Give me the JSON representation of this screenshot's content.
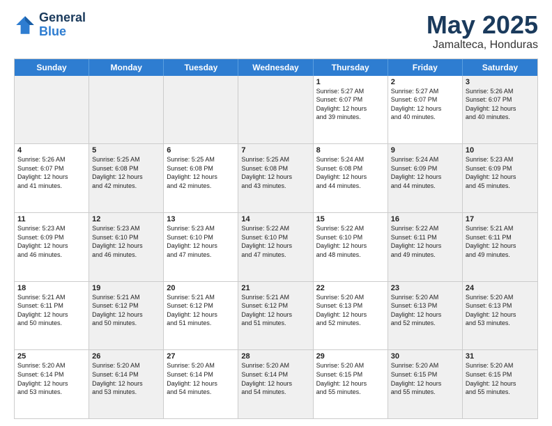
{
  "header": {
    "logo_line1": "General",
    "logo_line2": "Blue",
    "title": "May 2025",
    "subtitle": "Jamalteca, Honduras"
  },
  "weekdays": [
    "Sunday",
    "Monday",
    "Tuesday",
    "Wednesday",
    "Thursday",
    "Friday",
    "Saturday"
  ],
  "rows": [
    [
      {
        "day": "",
        "text": "",
        "shade": true
      },
      {
        "day": "",
        "text": "",
        "shade": true
      },
      {
        "day": "",
        "text": "",
        "shade": true
      },
      {
        "day": "",
        "text": "",
        "shade": true
      },
      {
        "day": "1",
        "text": "Sunrise: 5:27 AM\nSunset: 6:07 PM\nDaylight: 12 hours\nand 39 minutes."
      },
      {
        "day": "2",
        "text": "Sunrise: 5:27 AM\nSunset: 6:07 PM\nDaylight: 12 hours\nand 40 minutes."
      },
      {
        "day": "3",
        "text": "Sunrise: 5:26 AM\nSunset: 6:07 PM\nDaylight: 12 hours\nand 40 minutes.",
        "shade": true
      }
    ],
    [
      {
        "day": "4",
        "text": "Sunrise: 5:26 AM\nSunset: 6:07 PM\nDaylight: 12 hours\nand 41 minutes."
      },
      {
        "day": "5",
        "text": "Sunrise: 5:25 AM\nSunset: 6:08 PM\nDaylight: 12 hours\nand 42 minutes.",
        "shade": true
      },
      {
        "day": "6",
        "text": "Sunrise: 5:25 AM\nSunset: 6:08 PM\nDaylight: 12 hours\nand 42 minutes."
      },
      {
        "day": "7",
        "text": "Sunrise: 5:25 AM\nSunset: 6:08 PM\nDaylight: 12 hours\nand 43 minutes.",
        "shade": true
      },
      {
        "day": "8",
        "text": "Sunrise: 5:24 AM\nSunset: 6:08 PM\nDaylight: 12 hours\nand 44 minutes."
      },
      {
        "day": "9",
        "text": "Sunrise: 5:24 AM\nSunset: 6:09 PM\nDaylight: 12 hours\nand 44 minutes.",
        "shade": true
      },
      {
        "day": "10",
        "text": "Sunrise: 5:23 AM\nSunset: 6:09 PM\nDaylight: 12 hours\nand 45 minutes.",
        "shade": true
      }
    ],
    [
      {
        "day": "11",
        "text": "Sunrise: 5:23 AM\nSunset: 6:09 PM\nDaylight: 12 hours\nand 46 minutes."
      },
      {
        "day": "12",
        "text": "Sunrise: 5:23 AM\nSunset: 6:10 PM\nDaylight: 12 hours\nand 46 minutes.",
        "shade": true
      },
      {
        "day": "13",
        "text": "Sunrise: 5:23 AM\nSunset: 6:10 PM\nDaylight: 12 hours\nand 47 minutes."
      },
      {
        "day": "14",
        "text": "Sunrise: 5:22 AM\nSunset: 6:10 PM\nDaylight: 12 hours\nand 47 minutes.",
        "shade": true
      },
      {
        "day": "15",
        "text": "Sunrise: 5:22 AM\nSunset: 6:10 PM\nDaylight: 12 hours\nand 48 minutes."
      },
      {
        "day": "16",
        "text": "Sunrise: 5:22 AM\nSunset: 6:11 PM\nDaylight: 12 hours\nand 49 minutes.",
        "shade": true
      },
      {
        "day": "17",
        "text": "Sunrise: 5:21 AM\nSunset: 6:11 PM\nDaylight: 12 hours\nand 49 minutes.",
        "shade": true
      }
    ],
    [
      {
        "day": "18",
        "text": "Sunrise: 5:21 AM\nSunset: 6:11 PM\nDaylight: 12 hours\nand 50 minutes."
      },
      {
        "day": "19",
        "text": "Sunrise: 5:21 AM\nSunset: 6:12 PM\nDaylight: 12 hours\nand 50 minutes.",
        "shade": true
      },
      {
        "day": "20",
        "text": "Sunrise: 5:21 AM\nSunset: 6:12 PM\nDaylight: 12 hours\nand 51 minutes."
      },
      {
        "day": "21",
        "text": "Sunrise: 5:21 AM\nSunset: 6:12 PM\nDaylight: 12 hours\nand 51 minutes.",
        "shade": true
      },
      {
        "day": "22",
        "text": "Sunrise: 5:20 AM\nSunset: 6:13 PM\nDaylight: 12 hours\nand 52 minutes."
      },
      {
        "day": "23",
        "text": "Sunrise: 5:20 AM\nSunset: 6:13 PM\nDaylight: 12 hours\nand 52 minutes.",
        "shade": true
      },
      {
        "day": "24",
        "text": "Sunrise: 5:20 AM\nSunset: 6:13 PM\nDaylight: 12 hours\nand 53 minutes.",
        "shade": true
      }
    ],
    [
      {
        "day": "25",
        "text": "Sunrise: 5:20 AM\nSunset: 6:14 PM\nDaylight: 12 hours\nand 53 minutes."
      },
      {
        "day": "26",
        "text": "Sunrise: 5:20 AM\nSunset: 6:14 PM\nDaylight: 12 hours\nand 53 minutes.",
        "shade": true
      },
      {
        "day": "27",
        "text": "Sunrise: 5:20 AM\nSunset: 6:14 PM\nDaylight: 12 hours\nand 54 minutes."
      },
      {
        "day": "28",
        "text": "Sunrise: 5:20 AM\nSunset: 6:14 PM\nDaylight: 12 hours\nand 54 minutes.",
        "shade": true
      },
      {
        "day": "29",
        "text": "Sunrise: 5:20 AM\nSunset: 6:15 PM\nDaylight: 12 hours\nand 55 minutes."
      },
      {
        "day": "30",
        "text": "Sunrise: 5:20 AM\nSunset: 6:15 PM\nDaylight: 12 hours\nand 55 minutes.",
        "shade": true
      },
      {
        "day": "31",
        "text": "Sunrise: 5:20 AM\nSunset: 6:15 PM\nDaylight: 12 hours\nand 55 minutes.",
        "shade": true
      }
    ]
  ]
}
